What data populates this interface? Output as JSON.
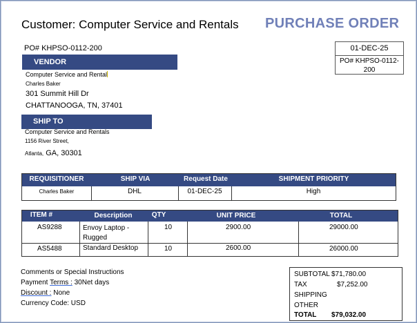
{
  "header": {
    "customer": "Customer: Computer Service and Rentals",
    "title": "PURCHASE ORDER",
    "po_number": "PO# KHPSO-0112-200",
    "date": "01-DEC-25",
    "po_box_line1": "PO# KHPSO-0112-",
    "po_box_line2": "200"
  },
  "vendor": {
    "label": "VENDOR",
    "company": "Computer Service and Rental",
    "contact": "Charles Baker",
    "street": "301 Summit Hill Dr",
    "city": "CHATTANOOGA, TN, 37401"
  },
  "ship_to": {
    "label": "SHIP TO",
    "company": "Computer Service and Rentals",
    "street": "1156 River Street,",
    "city_part": "Atlanta,",
    "state_zip": " GA, 30301"
  },
  "shipping_table": {
    "headers": [
      "REQUISITIONER",
      "SHIP VIA",
      "Request Date",
      "SHIPMENT PRIORITY"
    ],
    "row": [
      "Charles Baker",
      "DHL",
      "01-DEC-25",
      "High"
    ]
  },
  "items_table": {
    "headers": [
      "ITEM #",
      "Description",
      "QTY",
      "UNIT PRICE",
      "TOTAL"
    ],
    "rows": [
      {
        "item": "AS9288",
        "desc1": "Envoy Laptop -",
        "desc2": "Rugged",
        "qty": "10",
        "price": "2900.00",
        "total": "29000.00"
      },
      {
        "item": "AS5488",
        "desc1": "Standard Desktop",
        "desc2": "",
        "qty": "10",
        "price": "2600.00",
        "total": "26000.00"
      }
    ]
  },
  "notes": {
    "comments": "Comments or Special Instructions",
    "terms_label": "Payment ",
    "terms_word": "Terms :",
    "terms_value": " 30Net days",
    "discount_word": "Discount :",
    "discount_value": " None",
    "currency": "Currency Code: USD"
  },
  "totals": {
    "subtotal_label": "SUBTOTAL",
    "subtotal_value": "$71,780.00",
    "tax_label": "TAX",
    "tax_value": "$7,252.00",
    "shipping_label": "SHIPPING",
    "other_label": "OTHER",
    "total_label": "TOTAL",
    "total_value": "$79,032.00"
  }
}
